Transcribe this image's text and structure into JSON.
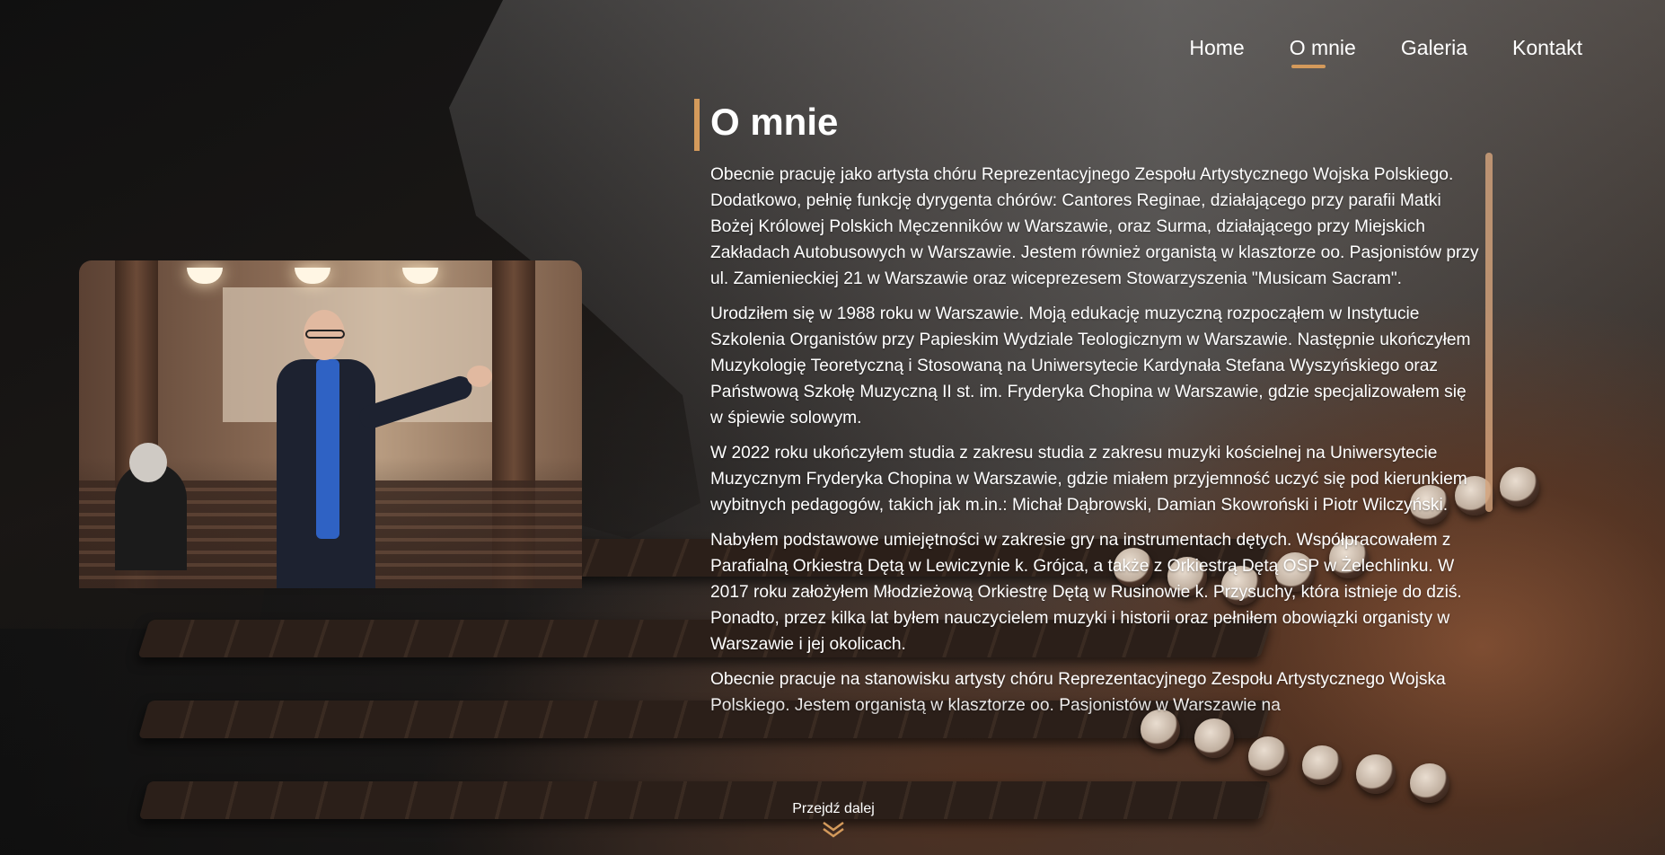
{
  "nav": {
    "items": [
      {
        "label": "Home"
      },
      {
        "label": "O mnie"
      },
      {
        "label": "Galeria"
      },
      {
        "label": "Kontakt"
      }
    ],
    "active": "O mnie"
  },
  "about": {
    "title": "O mnie",
    "paragraphs": [
      "Obecnie pracuję jako artysta chóru Reprezentacyjnego Zespołu Artystycznego Wojska Polskiego. Dodatkowo, pełnię funkcję dyrygenta chórów: Cantores Reginae, działającego przy parafii Matki Bożej Królowej Polskich Męczenników w Warszawie, oraz Surma, działającego przy Miejskich Zakładach Autobusowych w Warszawie. Jestem również organistą w klasztorze oo. Pasjonistów przy ul. Zamienieckiej 21 w Warszawie oraz wiceprezesem Stowarzyszenia \"Musicam Sacram\".",
      "Urodziłem się w 1988 roku w Warszawie. Moją edukację muzyczną rozpocząłem w Instytucie Szkolenia Organistów przy Papieskim Wydziale Teologicznym w Warszawie. Następnie ukończyłem Muzykologię Teoretyczną i Stosowaną na Uniwersytecie Kardynała Stefana Wyszyńskiego oraz Państwową Szkołę Muzyczną II st. im. Fryderyka Chopina w Warszawie, gdzie specjalizowałem się w śpiewie solowym.",
      "W 2022 roku ukończyłem studia z zakresu studia z zakresu muzyki kościelnej na Uniwersytecie Muzycznym Fryderyka Chopina w Warszawie, gdzie miałem przyjemność uczyć się pod kierunkiem wybitnych pedagogów, takich jak m.in.: Michał Dąbrowski, Damian Skowroński i Piotr Wilczyński.",
      "Nabyłem podstawowe umiejętności w zakresie gry na instrumentach dętych. Współpracowałem z Parafialną Orkiestrą Dętą w Lewiczynie k. Grójca, a także z Orkiestrą Dętą OSP w Żelechlinku. W 2017 roku założyłem Młodzieżową Orkiestrę Dętą w Rusinowie k. Przysuchy, która istnieje do dziś. Ponadto, przez kilka lat byłem nauczycielem muzyki i historii oraz pełniłem obowiązki organisty w Warszawie i jej okolicach.",
      "Obecnie pracuje na stanowisku artysty chóru Reprezentacyjnego Zespołu Artystycznego Wojska Polskiego. Jestem organistą w klasztorze oo. Pasjonistów w Warszawie na"
    ]
  },
  "scroll_hint": {
    "label": "Przejdź dalej",
    "icon": "double-chevron-down-icon"
  },
  "colors": {
    "accent": "#d49a5b"
  }
}
